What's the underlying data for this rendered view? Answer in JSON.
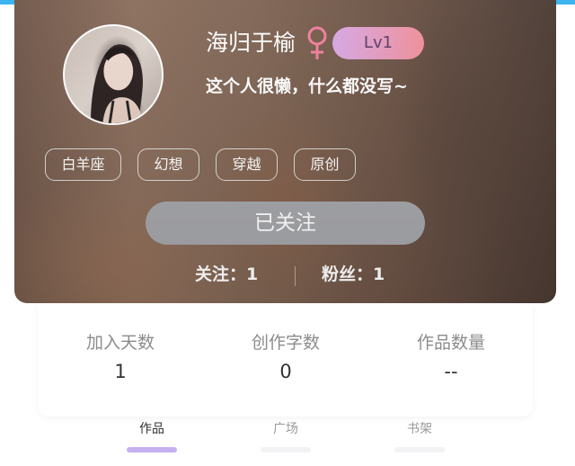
{
  "profile": {
    "username": "海归于榆",
    "gender_icon": "female-icon",
    "level": "Lv1",
    "bio": "这个人很懒，什么都没写~",
    "tags": [
      "白羊座",
      "幻想",
      "穿越",
      "原创"
    ],
    "follow_button_label": "已关注",
    "following": "关注：1",
    "fans": "粉丝：1"
  },
  "info": [
    {
      "label": "加入天数",
      "value": "1"
    },
    {
      "label": "创作字数",
      "value": "0"
    },
    {
      "label": "作品数量",
      "value": "--"
    }
  ],
  "tabs": [
    {
      "label": "作品",
      "active": true
    },
    {
      "label": "广场",
      "active": false
    },
    {
      "label": "书架",
      "active": false
    }
  ],
  "colors": {
    "accent_bar": "#3cb4f0",
    "gender_icon": "#f07f9a",
    "level_badge_start": "#d6a8e6",
    "level_badge_end": "#f08f9a",
    "follow_button": "#a4a5a9",
    "active_tab_indicator": "#c6b1ef"
  }
}
